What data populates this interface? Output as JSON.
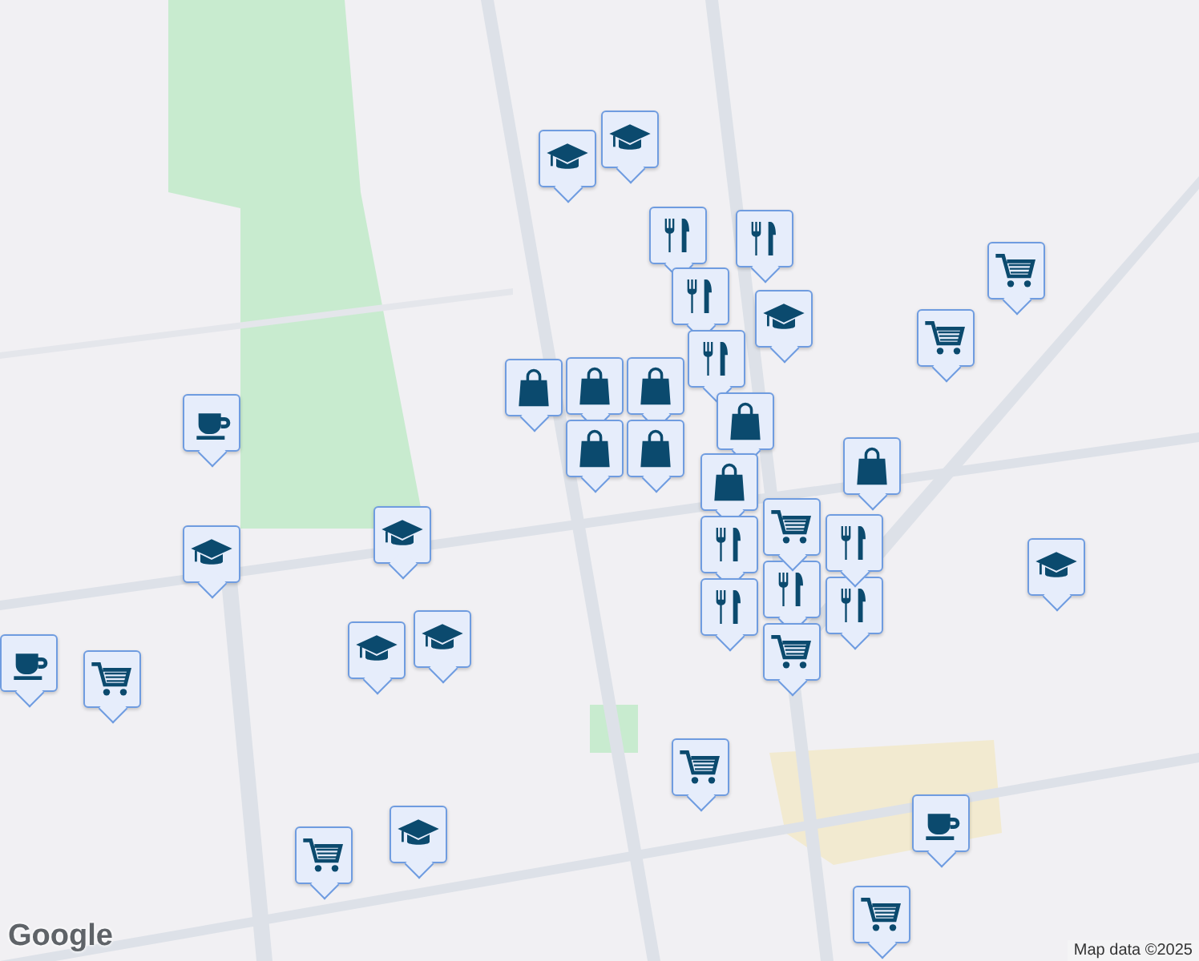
{
  "markers": [
    {
      "kind": "cafe"
    },
    {
      "kind": "school"
    },
    {
      "kind": "school"
    },
    {
      "kind": "cafe"
    },
    {
      "kind": "grocery"
    },
    {
      "kind": "school"
    },
    {
      "kind": "school"
    },
    {
      "kind": "school"
    },
    {
      "kind": "school"
    },
    {
      "kind": "restaurant"
    },
    {
      "kind": "restaurant"
    },
    {
      "kind": "restaurant"
    },
    {
      "kind": "school"
    },
    {
      "kind": "restaurant"
    },
    {
      "kind": "shopping"
    },
    {
      "kind": "shopping"
    },
    {
      "kind": "shopping"
    },
    {
      "kind": "shopping"
    },
    {
      "kind": "shopping"
    },
    {
      "kind": "shopping"
    },
    {
      "kind": "shopping"
    },
    {
      "kind": "shopping"
    },
    {
      "kind": "grocery"
    },
    {
      "kind": "grocery"
    },
    {
      "kind": "restaurant"
    },
    {
      "kind": "restaurant"
    },
    {
      "kind": "restaurant"
    },
    {
      "kind": "restaurant"
    },
    {
      "kind": "grocery"
    },
    {
      "kind": "restaurant"
    },
    {
      "kind": "grocery"
    },
    {
      "kind": "school"
    },
    {
      "kind": "grocery"
    },
    {
      "kind": "cafe"
    },
    {
      "kind": "school"
    },
    {
      "kind": "grocery"
    },
    {
      "kind": "grocery"
    }
  ],
  "logo": "Google",
  "attribution": "Map data ©2025"
}
